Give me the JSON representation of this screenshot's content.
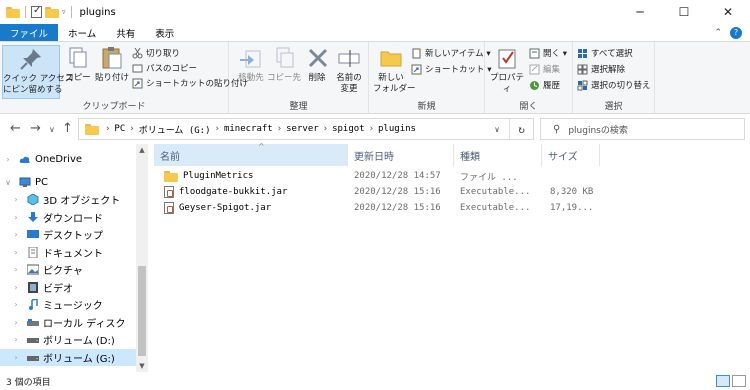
{
  "window": {
    "title": "plugins",
    "controls": {
      "minimize": "─",
      "maximize": "☐",
      "close": "✕"
    }
  },
  "tabs": [
    "ファイル",
    "ホーム",
    "共有",
    "表示"
  ],
  "ribbon": {
    "clipboard": {
      "label": "クリップボード",
      "pin": "クイック アクセス\nにピン留めする",
      "copy": "コピー",
      "paste": "貼り付け",
      "cut": "切り取り",
      "copy_path": "パスのコピー",
      "paste_shortcut": "ショートカットの貼り付け"
    },
    "organize": {
      "label": "整理",
      "move": "移動先",
      "copy_to": "コピー先",
      "delete": "削除",
      "rename": "名前の\n変更"
    },
    "new": {
      "label": "新規",
      "new_folder": "新しい\nフォルダー",
      "new_item": "新しいアイテム ▾",
      "shortcut": "ショートカット ▾"
    },
    "open": {
      "label": "開く",
      "properties": "プロパティ",
      "open": "開く ▾",
      "edit": "編集",
      "history": "履歴"
    },
    "select": {
      "label": "選択",
      "select_all": "すべて選択",
      "select_none": "選択解除",
      "invert": "選択の切り替え"
    }
  },
  "address": {
    "crumbs": [
      "PC",
      "ボリューム (G:)",
      "minecraft",
      "server",
      "spigot",
      "plugins"
    ],
    "search_placeholder": "pluginsの検索"
  },
  "nav": [
    {
      "label": "OneDrive",
      "icon": "cloud-icon"
    },
    {
      "label": "PC",
      "icon": "pc-icon"
    },
    {
      "label": "3D オブジェクト",
      "icon": "cube-icon"
    },
    {
      "label": "ダウンロード",
      "icon": "download-icon"
    },
    {
      "label": "デスクトップ",
      "icon": "desktop-icon"
    },
    {
      "label": "ドキュメント",
      "icon": "document-icon"
    },
    {
      "label": "ピクチャ",
      "icon": "picture-icon"
    },
    {
      "label": "ビデオ",
      "icon": "video-icon"
    },
    {
      "label": "ミュージック",
      "icon": "music-icon"
    },
    {
      "label": "ローカル ディスク",
      "icon": "drive-icon"
    },
    {
      "label": "ボリューム (D:)",
      "icon": "drive-icon"
    },
    {
      "label": "ボリューム (G:)",
      "icon": "drive-icon"
    }
  ],
  "columns": [
    "名前",
    "更新日時",
    "種類",
    "サイズ"
  ],
  "files": [
    {
      "name": "PluginMetrics",
      "date": "2020/12/28 14:57",
      "type": "ファイル ...",
      "size": "",
      "icon": "folder-icon"
    },
    {
      "name": "floodgate-bukkit.jar",
      "date": "2020/12/28 15:16",
      "type": "Executable...",
      "size": "8,320 KB",
      "icon": "jar-icon"
    },
    {
      "name": "Geyser-Spigot.jar",
      "date": "2020/12/28 15:16",
      "type": "Executable...",
      "size": "17,19...",
      "icon": "jar-icon"
    }
  ],
  "status": {
    "count": "3 個の項目"
  },
  "colors": {
    "accent": "#1979ca",
    "selection": "#cce8ff",
    "folder": "#f5c84e"
  }
}
